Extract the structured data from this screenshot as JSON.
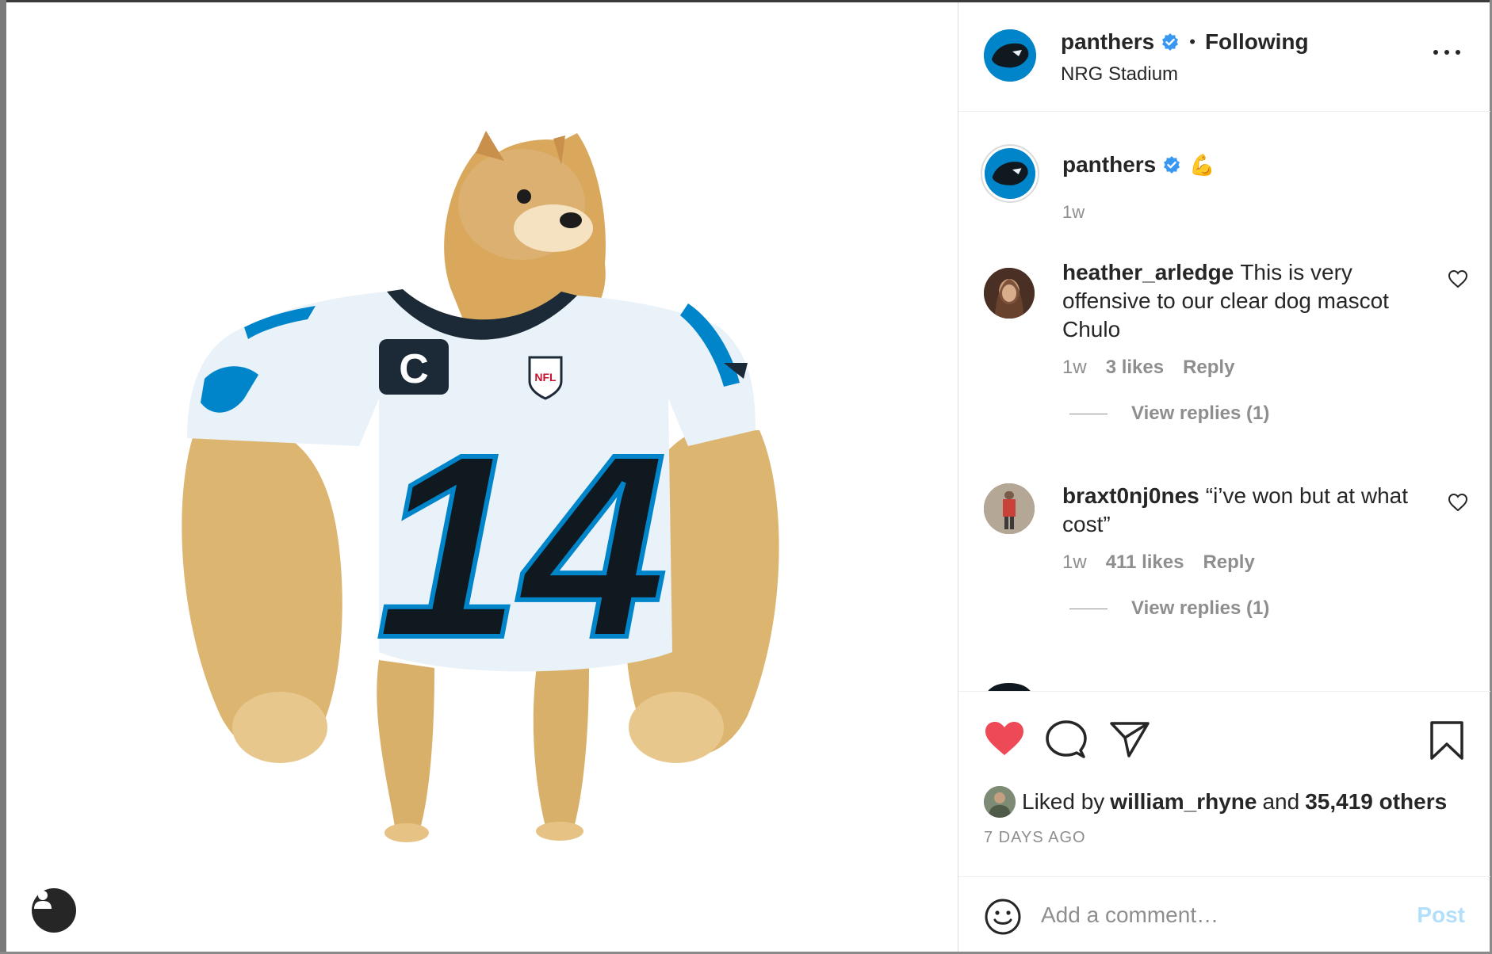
{
  "post": {
    "username": "panthers",
    "follow_status": "Following",
    "dot": "•",
    "location": "NRG Stadium",
    "jersey_number": "14",
    "captain_patch": "C",
    "nfl_shield": "NFL"
  },
  "caption": {
    "username": "panthers",
    "emoji": "💪",
    "time": "1w"
  },
  "comments": [
    {
      "username": "heather_arledge",
      "text": "This is very offensive to our clear dog mascot Chulo",
      "time": "1w",
      "likes": "3 likes",
      "reply_label": "Reply",
      "view_replies": "View replies (1)"
    },
    {
      "username": "braxt0nj0nes",
      "text": "“i’ve won but at what cost”",
      "time": "1w",
      "likes": "411 likes",
      "reply_label": "Reply",
      "view_replies": "View replies (1)"
    }
  ],
  "likes": {
    "prefix": "Liked by",
    "liker": "william_rhyne",
    "conjunction": "and",
    "others": "35,419 others"
  },
  "timestamp": "7 DAYS AGO",
  "comment_box": {
    "placeholder": "Add a comment…",
    "post_label": "Post"
  },
  "icons": {
    "like": "heart-filled-icon",
    "comment": "comment-bubble-icon",
    "share": "paper-plane-icon",
    "save": "bookmark-icon",
    "more": "more-options-icon",
    "emoji": "smiley-icon",
    "user_tag": "user-tag-icon",
    "verified": "verified-badge-icon"
  },
  "colors": {
    "like_red": "#ed4956",
    "verified_blue": "#3897f0",
    "post_disabled": "#b2dffc",
    "panthers_blue": "#0085ca",
    "secondary_text": "#8e8e8e"
  }
}
